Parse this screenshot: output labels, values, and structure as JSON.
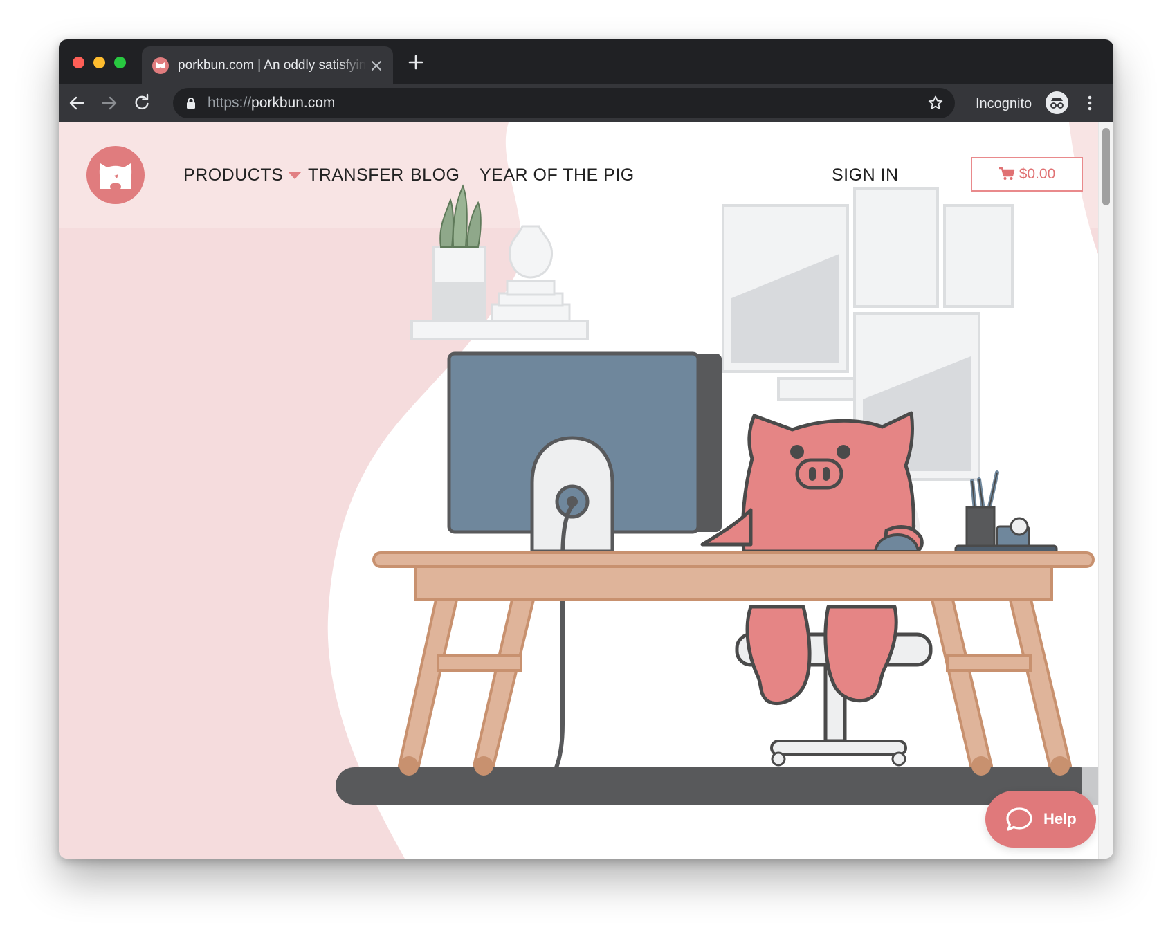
{
  "browser": {
    "tab": {
      "title": "porkbun.com | An oddly satisfying experience",
      "favicon": "pig-favicon-icon"
    },
    "url": {
      "protocol": "https://",
      "host": "porkbun.com"
    },
    "profile_label": "Incognito",
    "icons": {
      "back": "arrow-left-icon",
      "forward": "arrow-right-icon",
      "reload": "reload-icon",
      "lock": "lock-icon",
      "bookmark": "star-icon",
      "incognito": "incognito-icon",
      "menu": "kebab-menu-icon",
      "close_tab": "close-icon",
      "new_tab": "plus-icon"
    }
  },
  "site": {
    "nav": {
      "products": "PRODUCTS",
      "transfer": "TRANSFER",
      "blog": "BLOG",
      "year_of_pig": "YEAR OF THE PIG",
      "sign_in": "SIGN IN"
    },
    "cart": {
      "total": "$0.00"
    },
    "help": {
      "label": "Help"
    }
  },
  "colors": {
    "brand_pink": "#e07c7e",
    "page_background": "#f5dcdd",
    "chrome_dark": "#202124",
    "chrome_toolbar": "#35363a"
  }
}
